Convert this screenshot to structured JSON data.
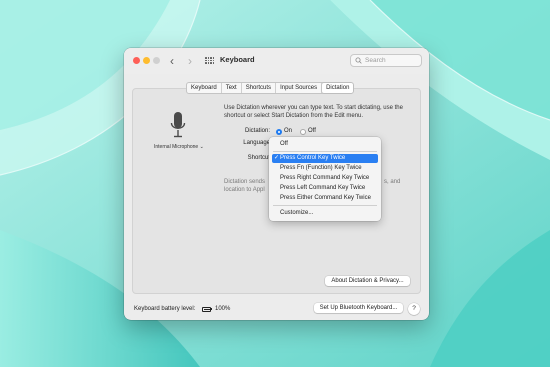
{
  "window": {
    "title": "Keyboard",
    "search_placeholder": "Search",
    "nav_back": "‹",
    "nav_forward": "›"
  },
  "tabs": [
    {
      "label": "Keyboard",
      "active": false
    },
    {
      "label": "Text",
      "active": false
    },
    {
      "label": "Shortcuts",
      "active": false
    },
    {
      "label": "Input Sources",
      "active": false
    },
    {
      "label": "Dictation",
      "active": true
    }
  ],
  "dictation": {
    "description": "Use Dictation wherever you can type text. To start dictating, use the shortcut or select Start Dictation from the Edit menu.",
    "mic_label": "Internal Microphone ⌄",
    "dictation_label": "Dictation:",
    "on_label": "On",
    "off_label": "Off",
    "language_label": "Language",
    "shortcut_label": "Shortcut",
    "info_line1_visible": "Dictation sends",
    "info_line1_tail": "s, and",
    "info_line2_visible": "location to Appl",
    "about_button": "About Dictation & Privacy..."
  },
  "shortcut_menu": {
    "items": [
      {
        "label": "Off",
        "selected": false
      },
      {
        "label": "Press Control Key Twice",
        "selected": true
      },
      {
        "label": "Press Fn (Function) Key Twice",
        "selected": false
      },
      {
        "label": "Press Right Command Key Twice",
        "selected": false
      },
      {
        "label": "Press Left Command Key Twice",
        "selected": false
      },
      {
        "label": "Press Either Command Key Twice",
        "selected": false
      },
      {
        "label": "Customize...",
        "selected": false
      }
    ],
    "checkmark": "✓"
  },
  "footer": {
    "battery_label": "Keyboard battery level:",
    "battery_percent": "100%",
    "bluetooth_button": "Set Up Bluetooth Keyboard...",
    "help_button": "?"
  },
  "colors": {
    "accent": "#2a7ff2",
    "desktop": "#7fe0d8"
  }
}
